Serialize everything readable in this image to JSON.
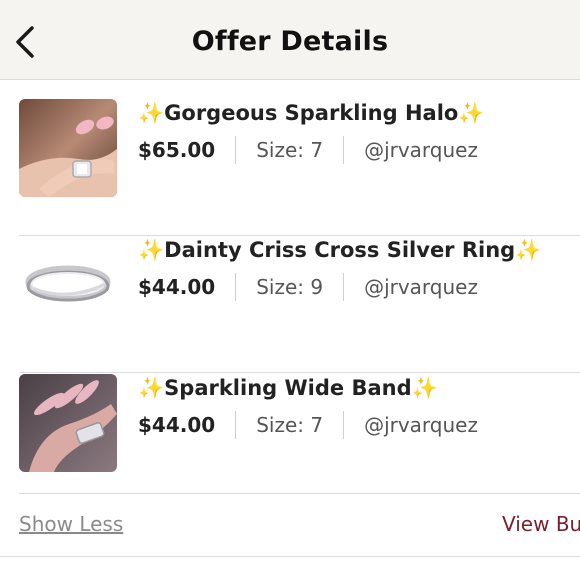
{
  "header": {
    "title": "Offer Details",
    "back_icon": "chevron-left-icon"
  },
  "items": [
    {
      "sparkle_left": "✨",
      "name": "Gorgeous Sparkling Halo",
      "sparkle_right": "✨",
      "price": "$65.00",
      "size": "Size: 7",
      "seller": "@jrvarquez"
    },
    {
      "sparkle_left": "✨",
      "name": "Dainty Criss Cross Silver Ring",
      "sparkle_right": "✨",
      "price": "$44.00",
      "size": "Size: 9",
      "seller": "@jrvarquez"
    },
    {
      "sparkle_left": "✨",
      "name": "Sparkling Wide Band",
      "sparkle_right": "✨",
      "price": "$44.00",
      "size": "Size: 7",
      "seller": "@jrvarquez"
    }
  ],
  "footer": {
    "show_less": "Show Less",
    "view_bundle": "View Bu"
  },
  "colors": {
    "header_bg": "#f6f4f1",
    "accent": "#7a1f2b",
    "sparkle": "#f1c232"
  }
}
